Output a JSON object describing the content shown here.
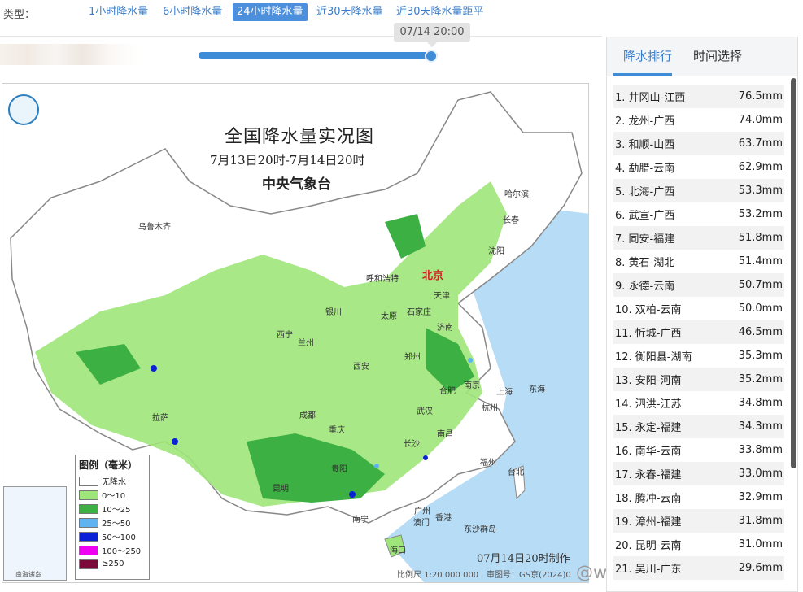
{
  "type_bar": {
    "label": "类型：",
    "tabs": [
      {
        "label": "1小时降水量"
      },
      {
        "label": "6小时降水量"
      },
      {
        "label": "24小时降水量"
      },
      {
        "label": "近30天降水量"
      },
      {
        "label": "近30天降水量距平"
      }
    ],
    "active_tab": "24小时降水量"
  },
  "time_slider": {
    "tooltip": "07/14 20:00",
    "progress": 1.0
  },
  "map": {
    "title": "全国降水量实况图",
    "subtitle": "7月13日20时-7月14日20时",
    "agency": "中央气象台",
    "cities": [
      "乌鲁木齐",
      "哈尔滨",
      "长春",
      "沈阳",
      "呼和浩特",
      "北京",
      "天津",
      "石家庄",
      "太原",
      "银川",
      "济南",
      "西宁",
      "兰州",
      "郑州",
      "西安",
      "合肥",
      "南京",
      "上海",
      "拉萨",
      "成都",
      "武汉",
      "杭州",
      "重庆",
      "南昌",
      "长沙",
      "福州",
      "台北",
      "贵阳",
      "昆明",
      "广州",
      "南宁",
      "澳门",
      "香港",
      "海口",
      "东沙群岛",
      "东海"
    ],
    "legend": {
      "title": "图例（毫米）",
      "items": [
        {
          "label": "无降水",
          "color": "#ffffff"
        },
        {
          "label": "0～10",
          "color": "#9ee57a"
        },
        {
          "label": "10～25",
          "color": "#3cb043"
        },
        {
          "label": "25～50",
          "color": "#5fb3f1"
        },
        {
          "label": "50～100",
          "color": "#0a21d8"
        },
        {
          "label": "100～250",
          "color": "#f000f0"
        },
        {
          "label": "≥250",
          "color": "#7a0a3a"
        }
      ]
    },
    "inset_caption": "南海诸岛",
    "scale_text": "比例尺 1:20 000 000",
    "approval_text": "审图号：GS京(2024)0",
    "made_time": "07月14日20时制作",
    "watermark": "@weatherman_倍欣"
  },
  "panel": {
    "tabs": [
      {
        "label": "降水排行"
      },
      {
        "label": "时间选择"
      }
    ],
    "active_tab": "降水排行",
    "ranking": [
      {
        "name": "1. 井冈山-江西",
        "value": "76.5mm"
      },
      {
        "name": "2. 龙州-广西",
        "value": "74.0mm"
      },
      {
        "name": "3. 和顺-山西",
        "value": "63.7mm"
      },
      {
        "name": "4. 勐腊-云南",
        "value": "62.9mm"
      },
      {
        "name": "5. 北海-广西",
        "value": "53.3mm"
      },
      {
        "name": "6. 武宣-广西",
        "value": "53.2mm"
      },
      {
        "name": "7. 同安-福建",
        "value": "51.8mm"
      },
      {
        "name": "8. 黄石-湖北",
        "value": "51.4mm"
      },
      {
        "name": "9. 永德-云南",
        "value": "50.7mm"
      },
      {
        "name": "10. 双柏-云南",
        "value": "50.0mm"
      },
      {
        "name": "11. 忻城-广西",
        "value": "46.5mm"
      },
      {
        "name": "12. 衡阳县-湖南",
        "value": "35.3mm"
      },
      {
        "name": "13. 安阳-河南",
        "value": "35.2mm"
      },
      {
        "name": "14. 泗洪-江苏",
        "value": "34.8mm"
      },
      {
        "name": "15. 永定-福建",
        "value": "34.3mm"
      },
      {
        "name": "16. 南华-云南",
        "value": "33.8mm"
      },
      {
        "name": "17. 永春-福建",
        "value": "33.0mm"
      },
      {
        "name": "18. 腾冲-云南",
        "value": "32.9mm"
      },
      {
        "name": "19. 漳州-福建",
        "value": "31.8mm"
      },
      {
        "name": "20. 昆明-云南",
        "value": "31.0mm"
      },
      {
        "name": "21. 吴川-广东",
        "value": "29.6mm"
      }
    ]
  },
  "colors": {
    "accent": "#3e8bd8",
    "sea": "#a9d4f2",
    "land": "#ffffff",
    "light_rain": "#9ee57a",
    "moderate_rain": "#3cb043"
  }
}
